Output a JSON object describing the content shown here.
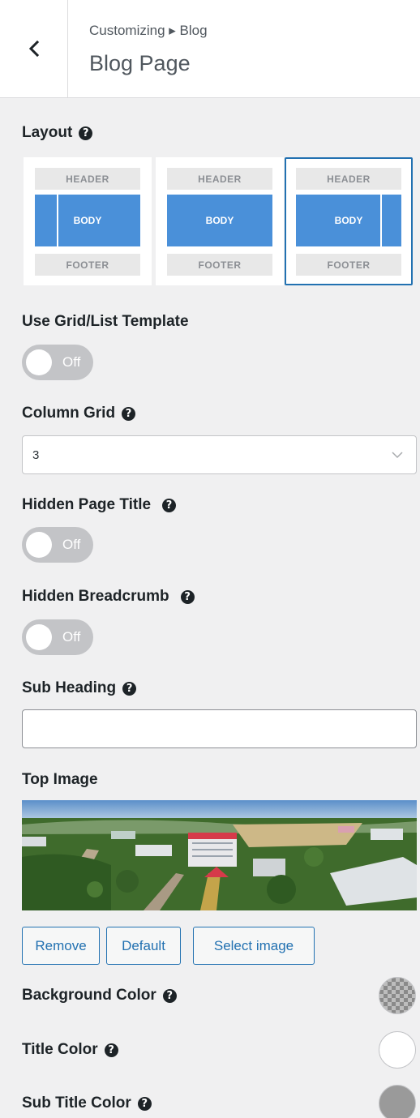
{
  "header": {
    "breadcrumb": "Customizing ▸ Blog",
    "title": "Blog Page"
  },
  "layout": {
    "label": "Layout",
    "options": [
      {
        "header": "HEADER",
        "body": "BODY",
        "footer": "FOOTER",
        "sidebar": "left"
      },
      {
        "header": "HEADER",
        "body": "BODY",
        "footer": "FOOTER",
        "sidebar": "none"
      },
      {
        "header": "HEADER",
        "body": "BODY",
        "footer": "FOOTER",
        "sidebar": "right"
      }
    ],
    "selected_index": 2
  },
  "grid_list": {
    "label": "Use Grid/List Template",
    "toggle_text": "Off"
  },
  "column_grid": {
    "label": "Column Grid",
    "value": "3"
  },
  "hidden_title": {
    "label": "Hidden Page Title",
    "toggle_text": "Off"
  },
  "hidden_breadcrumb": {
    "label": "Hidden Breadcrumb",
    "toggle_text": "Off"
  },
  "sub_heading": {
    "label": "Sub Heading",
    "value": ""
  },
  "top_image": {
    "label": "Top Image",
    "buttons": {
      "remove": "Remove",
      "default": "Default",
      "select": "Select image"
    }
  },
  "colors": {
    "background": {
      "label": "Background Color",
      "value": "transparent"
    },
    "title": {
      "label": "Title Color",
      "value": "#ffffff"
    },
    "sub_title": {
      "label": "Sub Title Color",
      "value": "#9a9a9a"
    }
  },
  "help_glyph": "?",
  "accent": "#2271b1",
  "body_block_color": "#4a90d9"
}
